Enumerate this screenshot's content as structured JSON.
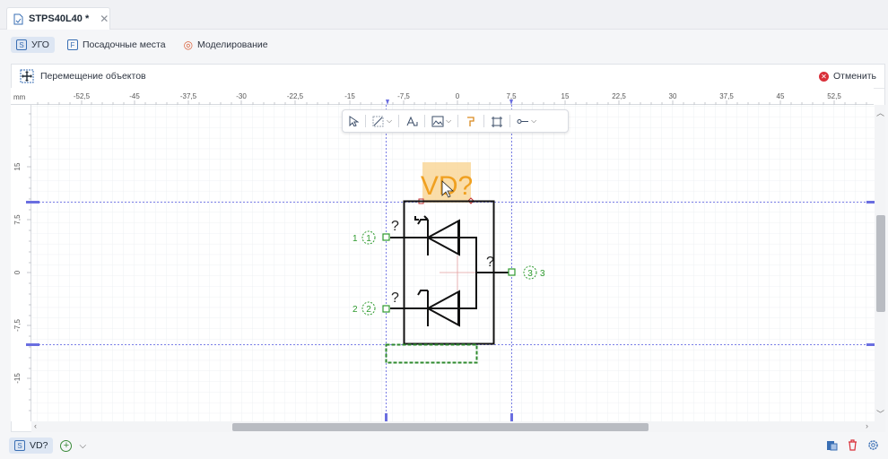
{
  "tab": {
    "name": "STPS40L40 *",
    "close": "✕"
  },
  "modes": [
    {
      "badge": "S",
      "label": "УГО"
    },
    {
      "badge": "F",
      "label": "Посадочные места"
    },
    {
      "badge": "◎",
      "label": "Моделирование"
    }
  ],
  "panel": {
    "title": "Перемещение объектов",
    "cancel": "Отменить"
  },
  "ruler": {
    "unit": "mm",
    "x_ticks": [
      "-52,5",
      "-45",
      "-37,5",
      "-30",
      "-22,5",
      "-15",
      "-7,5",
      "0",
      "7,5",
      "15",
      "22,5",
      "30",
      "37,5",
      "45",
      "52,5"
    ],
    "y_ticks": [
      "15",
      "7,5",
      "0",
      "-7,5",
      "-15"
    ]
  },
  "symbol": {
    "ref": "VD?",
    "pins": [
      {
        "num": "1",
        "circ": "1",
        "name": "?"
      },
      {
        "num": "2",
        "circ": "2",
        "name": "?"
      },
      {
        "num": "3",
        "circ": "3",
        "name": "?"
      }
    ]
  },
  "component_chip": {
    "badge": "S",
    "label": "VD?"
  },
  "colors": {
    "accent": "#3a6fb4",
    "pin_green": "#2e9a2e",
    "guide": "#6a6ee0",
    "ref_bg": "#f9d79a",
    "ref_text": "#f0a020"
  }
}
